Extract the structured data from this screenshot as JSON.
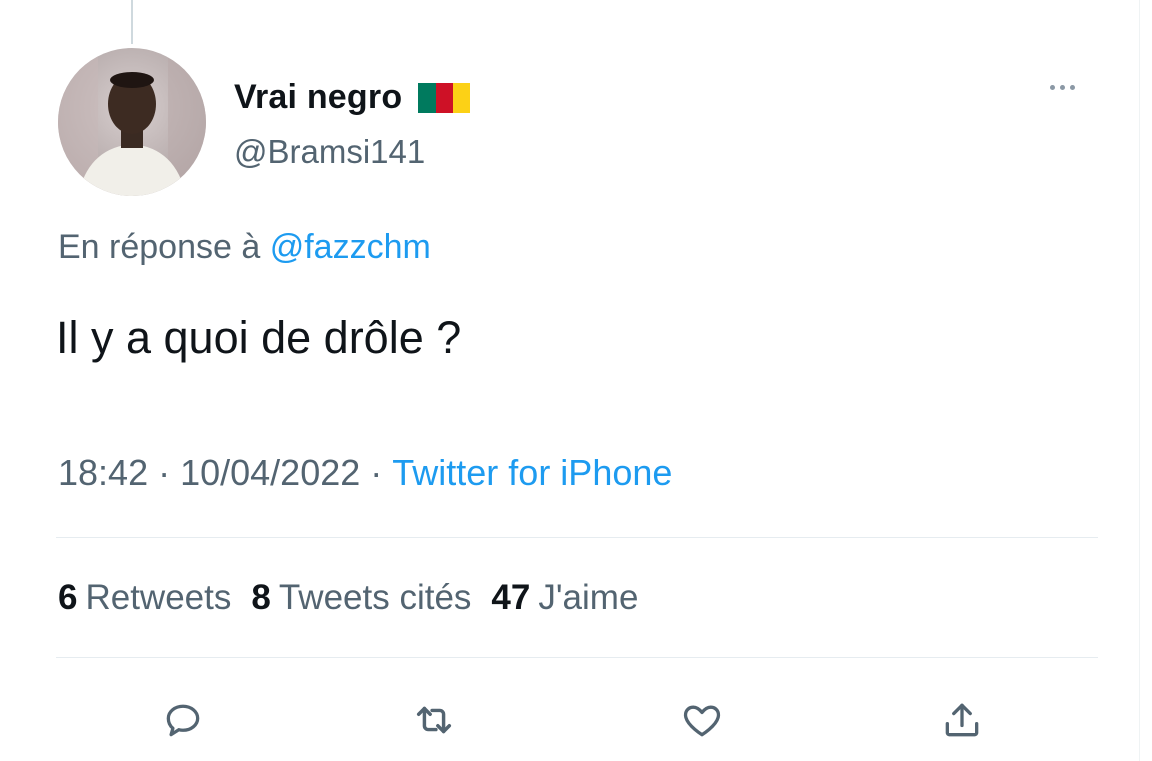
{
  "tweet": {
    "display_name": "Vrai negro",
    "handle": "@Bramsi141",
    "flag_icon": "cameroon-flag-icon",
    "reply_prefix": "En réponse à",
    "reply_mention": "@fazzchm",
    "text": "Il y a quoi de drôle ?",
    "time": "18:42",
    "date": "10/04/2022",
    "separator": "·",
    "source": "Twitter for iPhone"
  },
  "stats": {
    "retweets_count": "6",
    "retweets_label": "Retweets",
    "quotes_count": "8",
    "quotes_label": "Tweets cités",
    "likes_count": "47",
    "likes_label": "J'aime"
  },
  "actions": [
    {
      "icon": "reply-icon"
    },
    {
      "icon": "retweet-icon"
    },
    {
      "icon": "like-icon"
    },
    {
      "icon": "share-icon"
    }
  ],
  "colors": {
    "text_primary": "#0f1419",
    "text_secondary": "#536471",
    "accent": "#1d9bf0",
    "flag_green": "#007a5e",
    "flag_red": "#ce1126",
    "flag_yellow": "#fcd116"
  }
}
